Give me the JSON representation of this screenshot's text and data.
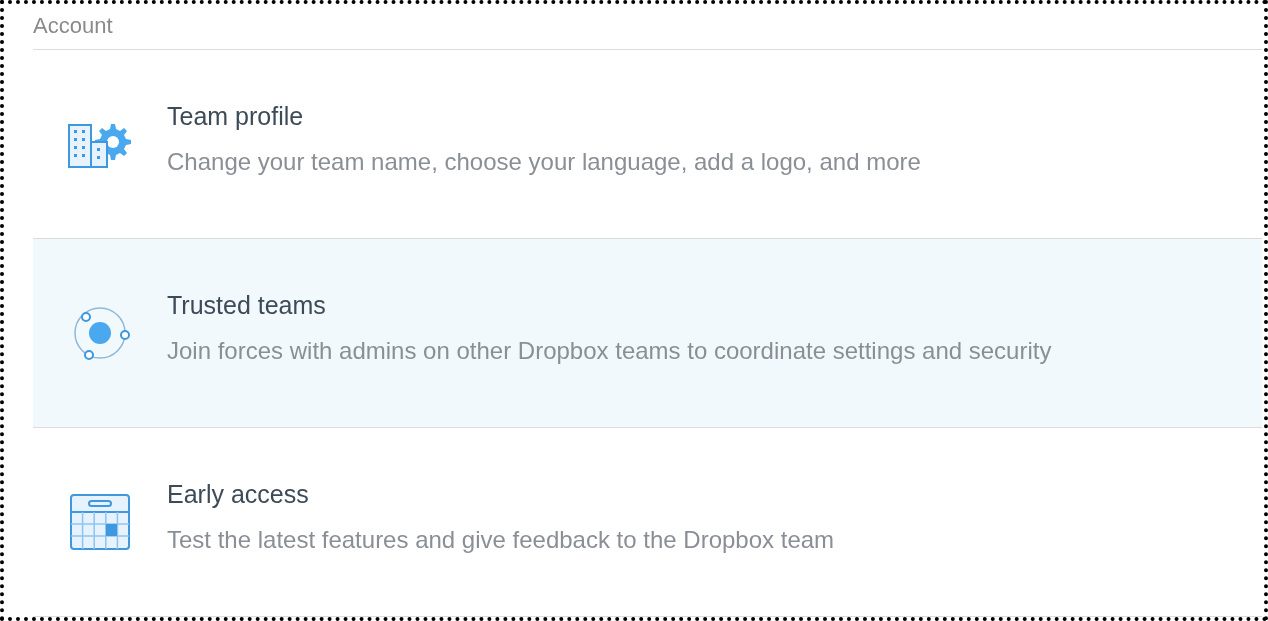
{
  "section": {
    "title": "Account"
  },
  "items": [
    {
      "kind": "team",
      "title": "Team profile",
      "description": "Change your team name, choose your language, add a logo, and more",
      "selected": false
    },
    {
      "kind": "trusted",
      "title": "Trusted teams",
      "description": "Join forces with admins on other Dropbox teams to coordinate settings and security",
      "selected": true
    },
    {
      "kind": "early",
      "title": "Early access",
      "description": "Test the latest features and give feedback to the Dropbox team",
      "selected": false
    }
  ]
}
